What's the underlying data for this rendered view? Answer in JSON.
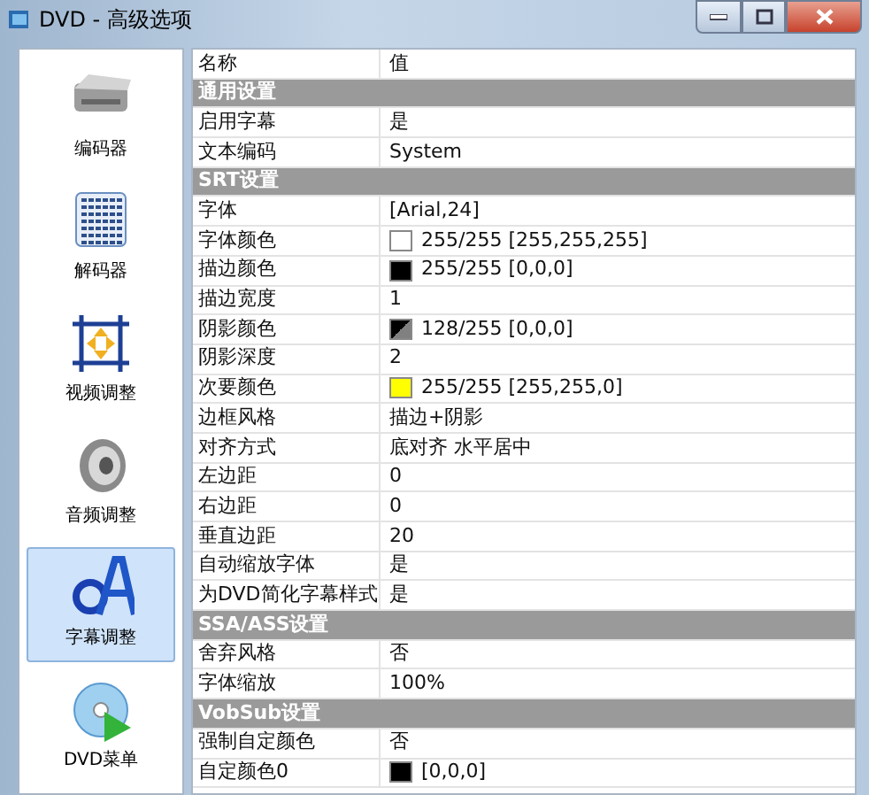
{
  "window": {
    "title": "DVD - 高级选项"
  },
  "sidebar": {
    "items": [
      {
        "label": "编码器",
        "selected": false
      },
      {
        "label": "解码器",
        "selected": false
      },
      {
        "label": "视频调整",
        "selected": false
      },
      {
        "label": "音频调整",
        "selected": false
      },
      {
        "label": "字幕调整",
        "selected": true
      },
      {
        "label": "DVD菜单",
        "selected": false
      }
    ]
  },
  "table": {
    "columns": [
      "名称",
      "值"
    ],
    "rows": [
      {
        "kind": "group",
        "name": "通用设置"
      },
      {
        "kind": "prop",
        "name": "启用字幕",
        "value": "是"
      },
      {
        "kind": "prop",
        "name": "文本编码",
        "value": "System"
      },
      {
        "kind": "group",
        "name": "SRT设置"
      },
      {
        "kind": "prop",
        "name": "字体",
        "value": "[Arial,24]"
      },
      {
        "kind": "color",
        "name": "字体颜色",
        "value": "255/255 [255,255,255]",
        "color": "#ffffff",
        "split": false
      },
      {
        "kind": "color",
        "name": "描边颜色",
        "value": "255/255 [0,0,0]",
        "color": "#000000",
        "split": false
      },
      {
        "kind": "prop",
        "name": "描边宽度",
        "value": "1"
      },
      {
        "kind": "color",
        "name": "阴影颜色",
        "value": "128/255 [0,0,0]",
        "color": "#000000",
        "split": true
      },
      {
        "kind": "prop",
        "name": "阴影深度",
        "value": "2"
      },
      {
        "kind": "color",
        "name": "次要颜色",
        "value": "255/255 [255,255,0]",
        "color": "#ffff00",
        "split": false
      },
      {
        "kind": "prop",
        "name": "边框风格",
        "value": "描边+阴影"
      },
      {
        "kind": "prop",
        "name": "对齐方式",
        "value": "底对齐 水平居中"
      },
      {
        "kind": "prop",
        "name": "左边距",
        "value": "0"
      },
      {
        "kind": "prop",
        "name": "右边距",
        "value": "0"
      },
      {
        "kind": "prop",
        "name": "垂直边距",
        "value": "20"
      },
      {
        "kind": "prop",
        "name": "自动缩放字体",
        "value": "是"
      },
      {
        "kind": "prop",
        "name": "为DVD简化字幕样式",
        "value": "是"
      },
      {
        "kind": "group",
        "name": "SSA/ASS设置"
      },
      {
        "kind": "prop",
        "name": "舍弃风格",
        "value": "否"
      },
      {
        "kind": "prop",
        "name": "字体缩放",
        "value": "100%"
      },
      {
        "kind": "group",
        "name": "VobSub设置"
      },
      {
        "kind": "prop",
        "name": "强制自定颜色",
        "value": "否"
      },
      {
        "kind": "color",
        "name": "自定颜色0",
        "value": "[0,0,0]",
        "color": "#000000",
        "split": false
      }
    ]
  }
}
